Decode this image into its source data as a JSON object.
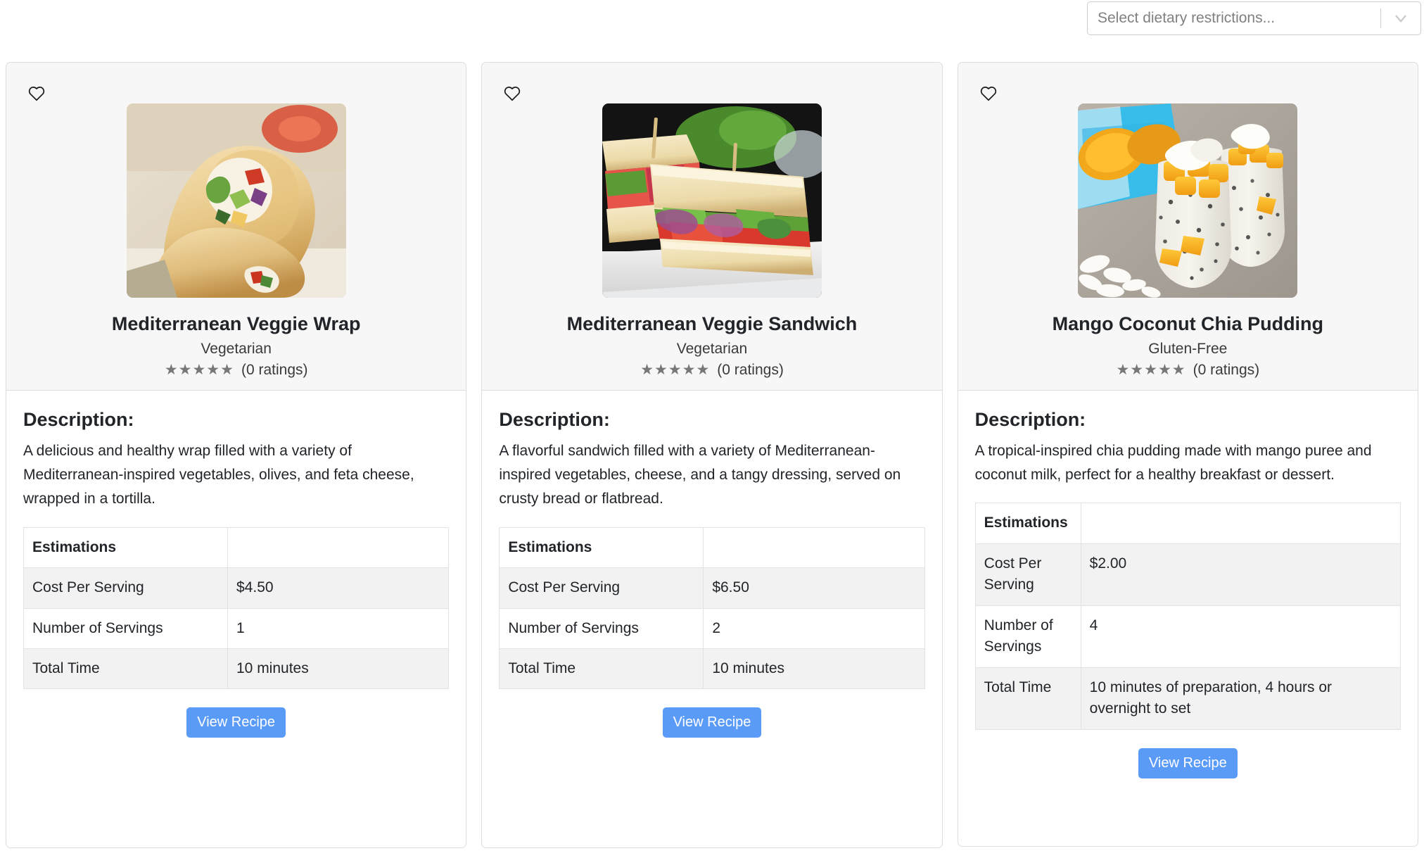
{
  "filter": {
    "placeholder": "Select dietary restrictions...",
    "value": "",
    "chevron_icon": "chevron-down-icon"
  },
  "labels": {
    "description_heading": "Description:",
    "view_recipe": "View Recipe",
    "favorite_icon": "heart-icon",
    "stars": "★★★★★"
  },
  "colors": {
    "accent": "#5b9bf8",
    "card_border": "#dddddd",
    "header_bg": "#f7f7f7",
    "row_stripe": "#f2f2f2",
    "star": "#777777",
    "text": "#212529"
  },
  "cards": [
    {
      "title": "Mediterranean Veggie Wrap",
      "diet": "Vegetarian",
      "rating_count": "(0 ratings)",
      "description": "A delicious and healthy wrap filled with a variety of Mediterranean-inspired vegetables, olives, and feta cheese, wrapped in a tortilla.",
      "image_alt": "mediterranean-veggie-wrap-photo",
      "table": {
        "header": "Estimations",
        "header_value": "",
        "rows": [
          {
            "key": "Cost Per Serving",
            "value": "$4.50"
          },
          {
            "key": "Number of Servings",
            "value": "1"
          },
          {
            "key": "Total Time",
            "value": "10 minutes"
          }
        ]
      }
    },
    {
      "title": "Mediterranean Veggie Sandwich",
      "diet": "Vegetarian",
      "rating_count": "(0 ratings)",
      "description": "A flavorful sandwich filled with a variety of Mediterranean-inspired vegetables, cheese, and a tangy dressing, served on crusty bread or flatbread.",
      "image_alt": "mediterranean-veggie-sandwich-photo",
      "table": {
        "header": "Estimations",
        "header_value": "",
        "rows": [
          {
            "key": "Cost Per Serving",
            "value": "$6.50"
          },
          {
            "key": "Number of Servings",
            "value": "2"
          },
          {
            "key": "Total Time",
            "value": "10 minutes"
          }
        ]
      }
    },
    {
      "title": "Mango Coconut Chia Pudding",
      "diet": "Gluten-Free",
      "rating_count": "(0 ratings)",
      "description": "A tropical-inspired chia pudding made with mango puree and coconut milk, perfect for a healthy breakfast or dessert.",
      "image_alt": "mango-coconut-chia-pudding-photo",
      "table": {
        "header": "Estimations",
        "header_value": "",
        "rows": [
          {
            "key": "Cost Per Serving",
            "value": "$2.00"
          },
          {
            "key": "Number of Servings",
            "value": "4"
          },
          {
            "key": "Total Time",
            "value": "10 minutes of preparation, 4 hours or overnight to set"
          }
        ]
      }
    }
  ]
}
